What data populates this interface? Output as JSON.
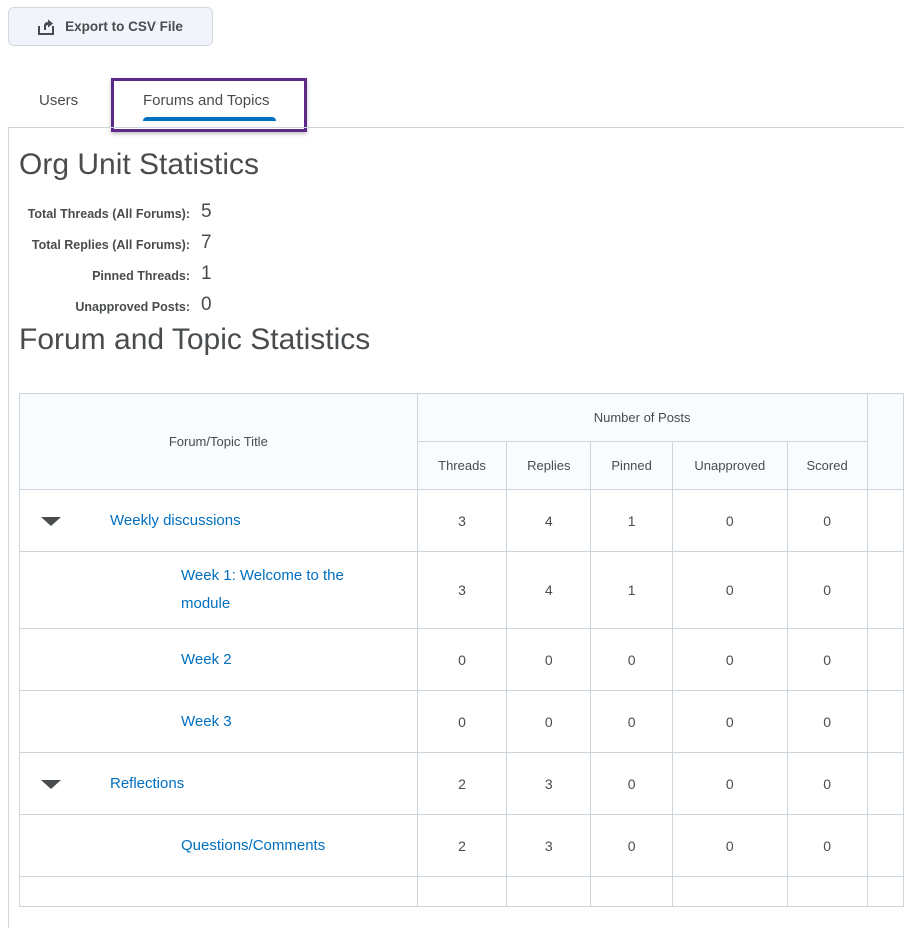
{
  "toolbar": {
    "export_label": "Export to CSV File",
    "export_icon": "export-icon"
  },
  "tabs": [
    {
      "label": "Users",
      "selected": false
    },
    {
      "label": "Forums and Topics",
      "selected": true
    }
  ],
  "org_stats": {
    "title": "Org Unit Statistics",
    "items": [
      {
        "label": "Total Threads (All Forums):",
        "value": "5"
      },
      {
        "label": "Total Replies (All Forums):",
        "value": "7"
      },
      {
        "label": "Pinned Threads:",
        "value": "1"
      },
      {
        "label": "Unapproved Posts:",
        "value": "0"
      }
    ]
  },
  "forum_stats": {
    "title": "Forum and Topic Statistics",
    "table": {
      "title_header": "Forum/Topic Title",
      "group_header": "Number of Posts",
      "columns": [
        "Threads",
        "Replies",
        "Pinned",
        "Unapproved",
        "Scored"
      ],
      "rows": [
        {
          "type": "forum",
          "title": "Weekly discussions",
          "values": [
            "3",
            "4",
            "1",
            "0",
            "0"
          ]
        },
        {
          "type": "topic",
          "title": "Week 1: Welcome to the module",
          "values": [
            "3",
            "4",
            "1",
            "0",
            "0"
          ]
        },
        {
          "type": "topic",
          "title": "Week 2",
          "values": [
            "0",
            "0",
            "0",
            "0",
            "0"
          ]
        },
        {
          "type": "topic",
          "title": "Week 3",
          "values": [
            "0",
            "0",
            "0",
            "0",
            "0"
          ]
        },
        {
          "type": "forum",
          "title": "Reflections",
          "values": [
            "2",
            "3",
            "0",
            "0",
            "0"
          ]
        },
        {
          "type": "topic",
          "title": "Questions/Comments",
          "values": [
            "2",
            "3",
            "0",
            "0",
            "0"
          ]
        }
      ]
    }
  }
}
